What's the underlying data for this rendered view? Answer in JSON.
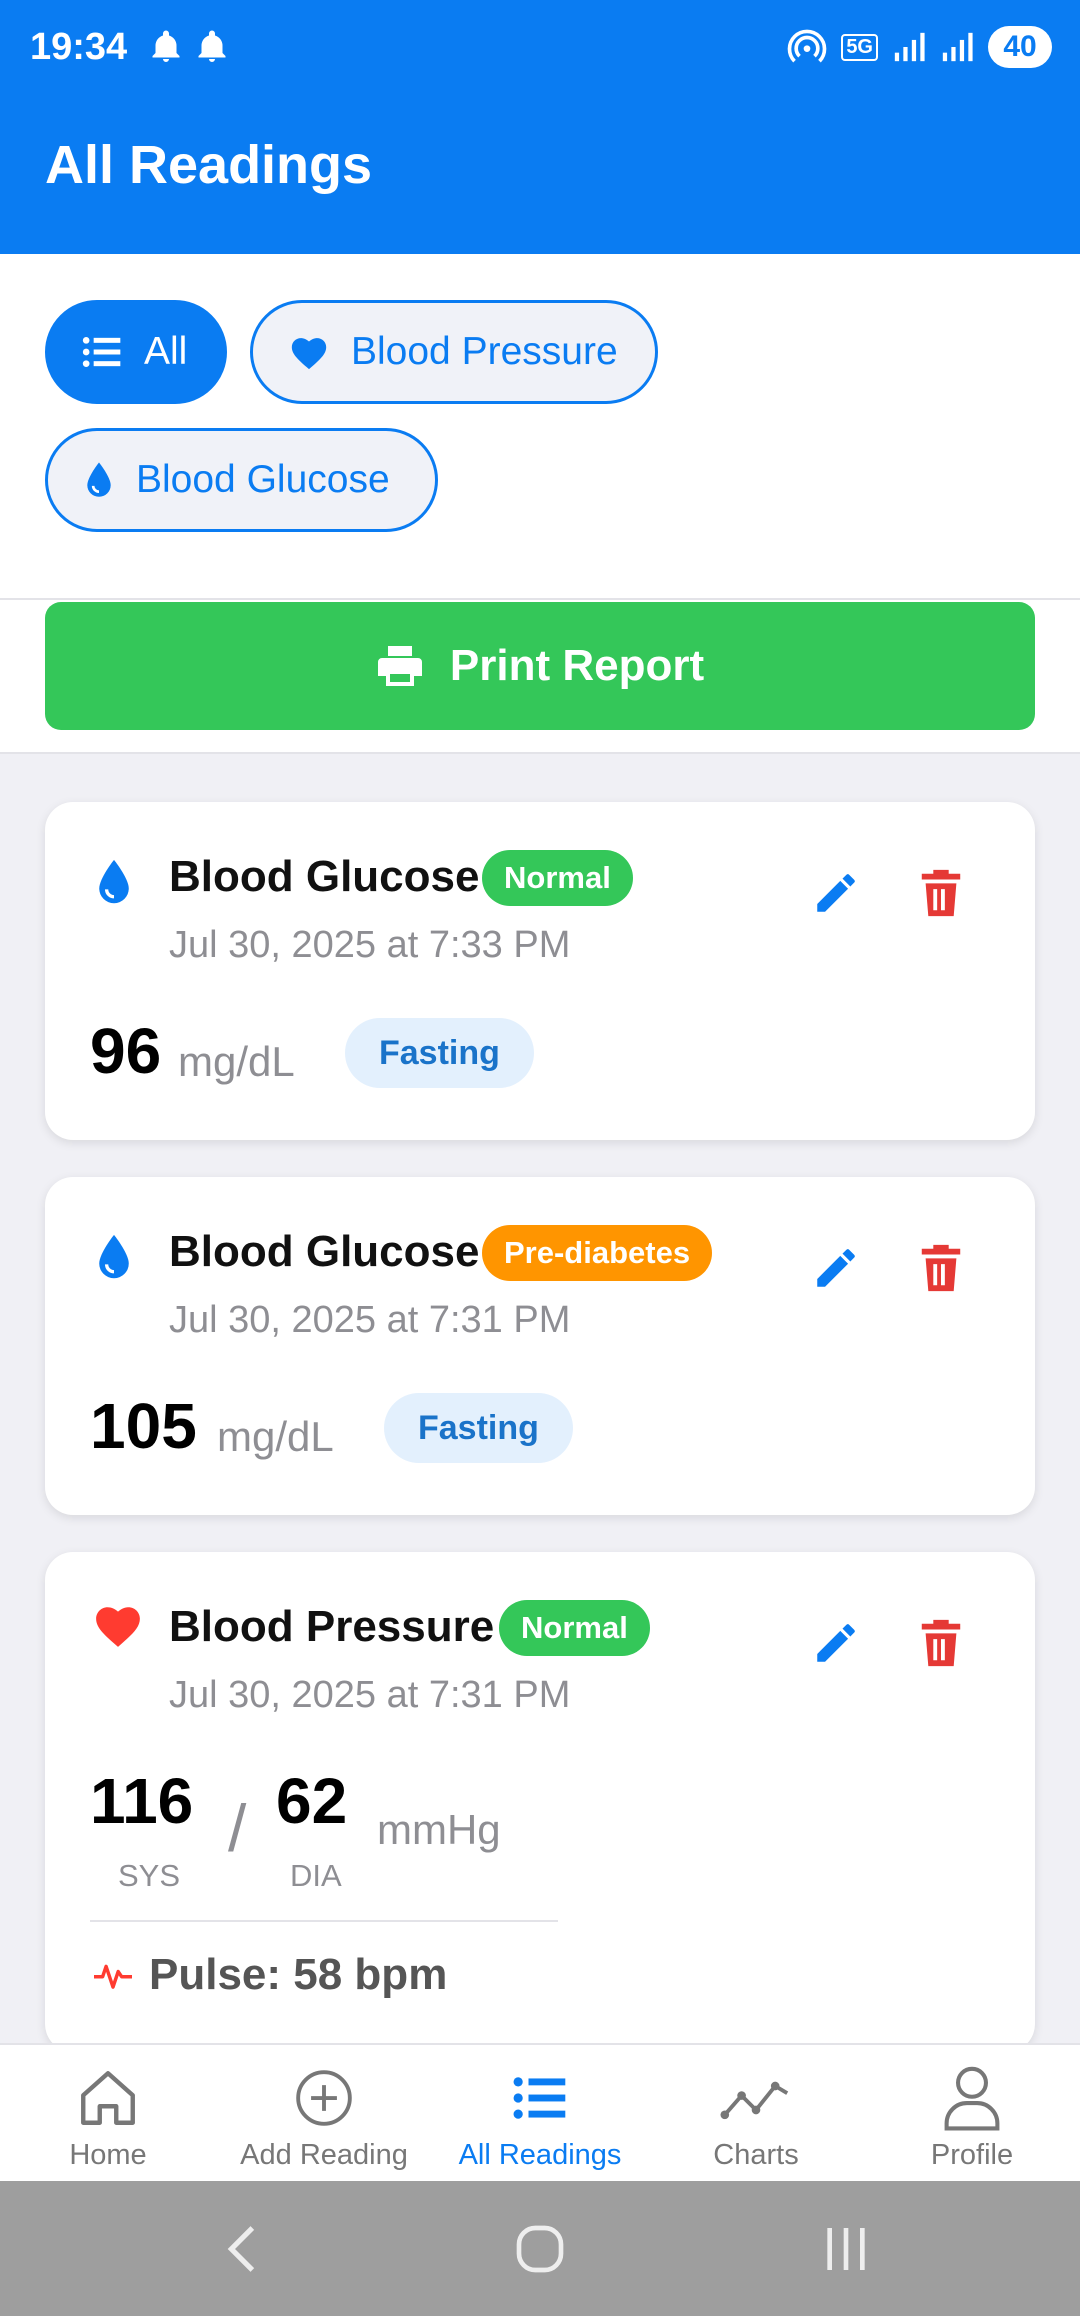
{
  "status_bar": {
    "time": "19:34",
    "network": "5G",
    "battery": "40"
  },
  "header": {
    "title": "All Readings"
  },
  "filters": [
    {
      "label": "All",
      "icon": "list-icon",
      "active": true
    },
    {
      "label": "Blood Pressure",
      "icon": "heart-icon",
      "active": false
    },
    {
      "label": "Blood Glucose",
      "icon": "drop-icon",
      "active": false
    }
  ],
  "print": {
    "label": "Print Report"
  },
  "readings": [
    {
      "type": "Blood Glucose",
      "status": "Normal",
      "status_color": "#34c759",
      "date": "Jul 30, 2025 at 7:33 PM",
      "value": "96",
      "unit": "mg/dL",
      "tag": "Fasting"
    },
    {
      "type": "Blood Glucose",
      "status": "Pre-diabetes",
      "status_color": "#ff9500",
      "date": "Jul 30, 2025 at 7:31 PM",
      "value": "105",
      "unit": "mg/dL",
      "tag": "Fasting"
    },
    {
      "type": "Blood Pressure",
      "status": "Normal",
      "status_color": "#34c759",
      "date": "Jul 30, 2025 at 7:31 PM",
      "systolic": "116",
      "diastolic": "62",
      "sys_label": "SYS",
      "dia_label": "DIA",
      "separator": "/",
      "unit": "mmHg",
      "pulse": "Pulse: 58 bpm"
    }
  ],
  "bottom_nav": [
    {
      "label": "Home",
      "icon": "home-icon",
      "active": false
    },
    {
      "label": "Add Reading",
      "icon": "add-circle-icon",
      "active": false
    },
    {
      "label": "All Readings",
      "icon": "list-icon",
      "active": true
    },
    {
      "label": "Charts",
      "icon": "chart-line-icon",
      "active": false
    },
    {
      "label": "Profile",
      "icon": "person-icon",
      "active": false
    }
  ],
  "colors": {
    "primary": "#0a7cf2",
    "success": "#34c759",
    "warning": "#ff9500",
    "danger": "#e53935"
  }
}
